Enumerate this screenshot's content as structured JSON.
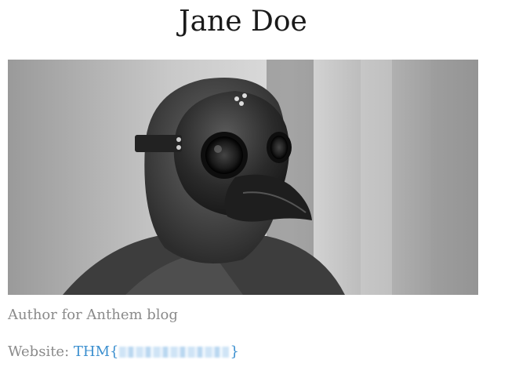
{
  "profile": {
    "name": "Jane Doe",
    "photo_alt": "Black and white photo of a person wearing a plague doctor mask",
    "bio": "Author for Anthem blog",
    "website_label": "Website: ",
    "website_prefix": "THM{",
    "website_suffix": "}"
  },
  "colors": {
    "title": "#1a1a1a",
    "text_muted": "#8a8a8a",
    "link": "#3b8fcf"
  }
}
